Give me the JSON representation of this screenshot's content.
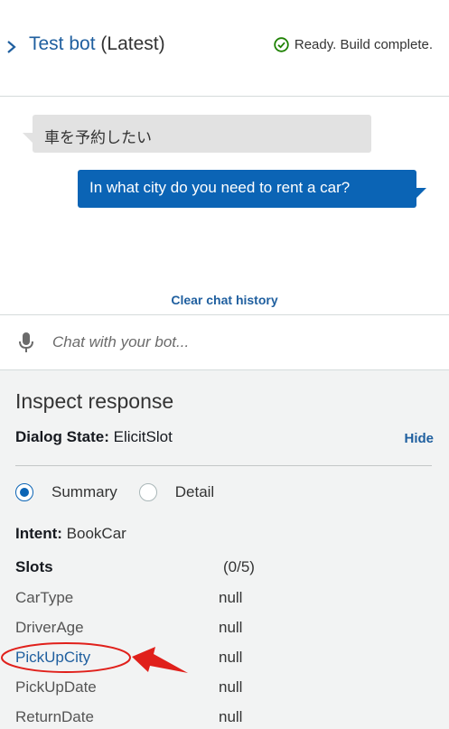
{
  "header": {
    "bot_name": "Test bot",
    "version": "(Latest)",
    "status": "Ready. Build complete.",
    "status_color": "#1d8102"
  },
  "chat": {
    "messages": [
      {
        "from": "user",
        "text": "車を予約したい"
      },
      {
        "from": "bot",
        "text": "In what city do you need to rent a car?"
      }
    ],
    "clear_label": "Clear chat history"
  },
  "input": {
    "placeholder": "Chat with your bot..."
  },
  "inspect": {
    "heading": "Inspect response",
    "dialog_state_label": "Dialog State:",
    "dialog_state_value": "ElicitSlot",
    "hide_label": "Hide",
    "view_options": [
      {
        "label": "Summary",
        "selected": true
      },
      {
        "label": "Detail",
        "selected": false
      }
    ],
    "intent_label": "Intent:",
    "intent_value": "BookCar",
    "slots_label": "Slots",
    "slots_count": "(0/5)",
    "slots": [
      {
        "name": "CarType",
        "value": "null"
      },
      {
        "name": "DriverAge",
        "value": "null"
      },
      {
        "name": "PickUpCity",
        "value": "null"
      },
      {
        "name": "PickUpDate",
        "value": "null"
      },
      {
        "name": "ReturnDate",
        "value": "null"
      }
    ]
  },
  "colors": {
    "accent": "#0b64b5",
    "link": "#1f5f9f",
    "annotation": "#e0201b"
  }
}
